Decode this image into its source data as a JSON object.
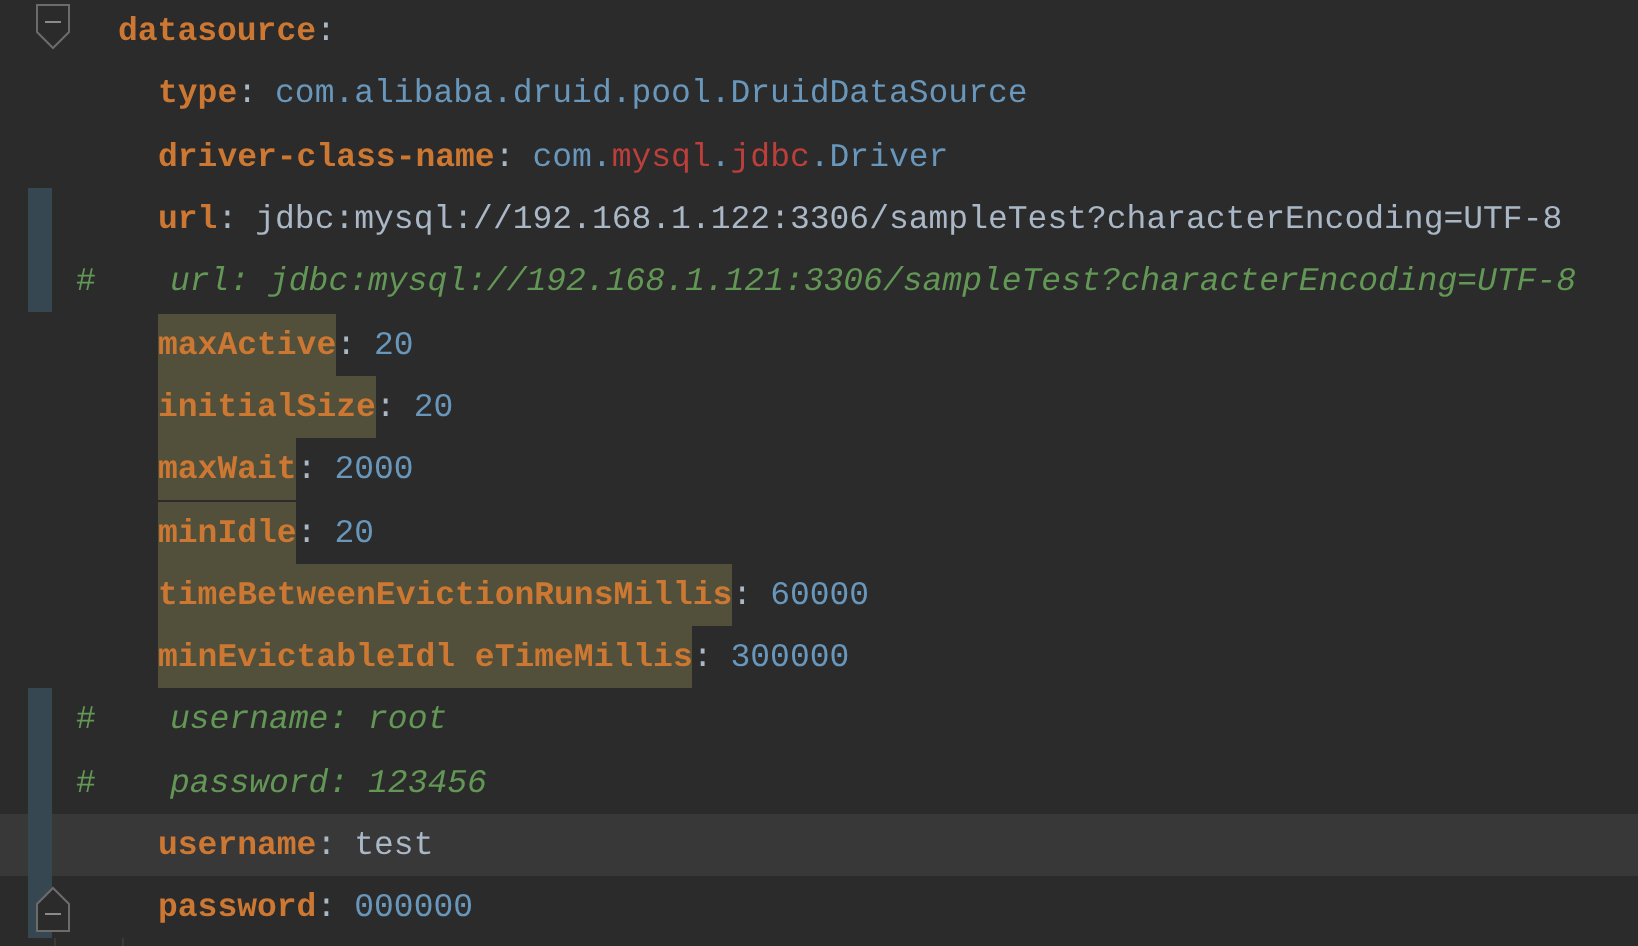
{
  "editor": {
    "lines": [
      {
        "kind": "key",
        "highlighted": false,
        "current": false,
        "changed": false,
        "tokens": [
          {
            "kind": "key",
            "text": "datasource"
          },
          {
            "kind": "punct",
            "text": ":"
          }
        ],
        "children": [
          {
            "kind": "key",
            "highlighted": false,
            "current": false,
            "changed": false,
            "tokens": [
              {
                "kind": "key",
                "text": "type"
              },
              {
                "kind": "punct",
                "text": ":"
              },
              {
                "kind": "value",
                "text": "com.alibaba.druid.pool.DruidDataSource"
              }
            ]
          },
          {
            "kind": "key",
            "highlighted": false,
            "current": false,
            "changed": false,
            "tokens": [
              {
                "kind": "key",
                "text": "driver-class-name"
              },
              {
                "kind": "punct",
                "text": ":"
              },
              {
                "kind": "value",
                "text": "com."
              },
              {
                "kind": "error",
                "text": "mysql"
              },
              {
                "kind": "value",
                "text": "."
              },
              {
                "kind": "error",
                "text": "jdbc"
              },
              {
                "kind": "value",
                "text": ".Driver"
              }
            ]
          },
          {
            "kind": "key",
            "highlighted": false,
            "current": false,
            "changed": true,
            "tokens": [
              {
                "kind": "key",
                "text": "url"
              },
              {
                "kind": "punct",
                "text": ":"
              },
              {
                "kind": "string",
                "text": "jdbc:mysql://192.168.1.122:3306/sampleTest?characterEncoding=UTF-8"
              }
            ]
          },
          {
            "kind": "comment",
            "highlighted": false,
            "current": false,
            "changed": true,
            "mark": "#",
            "text": "url: jdbc:mysql://192.168.1.121:3306/sampleTest?characterEncoding=UTF-8"
          },
          {
            "kind": "key",
            "highlighted": true,
            "current": false,
            "changed": false,
            "tokens": [
              {
                "kind": "key",
                "text": "maxActive"
              },
              {
                "kind": "punct",
                "text": ":"
              },
              {
                "kind": "number",
                "text": "20"
              }
            ]
          },
          {
            "kind": "key",
            "highlighted": true,
            "current": false,
            "changed": false,
            "tokens": [
              {
                "kind": "key",
                "text": "initialSize"
              },
              {
                "kind": "punct",
                "text": ":"
              },
              {
                "kind": "number",
                "text": "20"
              }
            ]
          },
          {
            "kind": "key",
            "highlighted": true,
            "current": false,
            "changed": false,
            "tokens": [
              {
                "kind": "key",
                "text": "maxWait"
              },
              {
                "kind": "punct",
                "text": ":"
              },
              {
                "kind": "number",
                "text": "2000"
              }
            ]
          },
          {
            "kind": "key",
            "highlighted": true,
            "current": false,
            "changed": false,
            "tokens": [
              {
                "kind": "key",
                "text": "minIdle"
              },
              {
                "kind": "punct",
                "text": ":"
              },
              {
                "kind": "number",
                "text": "20"
              }
            ]
          },
          {
            "kind": "key",
            "highlighted": true,
            "current": false,
            "changed": false,
            "tokens": [
              {
                "kind": "key",
                "text": "timeBetweenEvictionRunsMillis"
              },
              {
                "kind": "punct",
                "text": ":"
              },
              {
                "kind": "number",
                "text": "60000"
              }
            ]
          },
          {
            "kind": "key",
            "highlighted": true,
            "current": false,
            "changed": false,
            "tokens": [
              {
                "kind": "key",
                "text": "minEvictableIdl eTimeMillis"
              },
              {
                "kind": "punct",
                "text": ":"
              },
              {
                "kind": "number",
                "text": "300000"
              }
            ]
          },
          {
            "kind": "comment",
            "highlighted": false,
            "current": false,
            "changed": true,
            "mark": "#",
            "text": "username: root"
          },
          {
            "kind": "comment",
            "highlighted": false,
            "current": false,
            "changed": true,
            "mark": "#",
            "text": "password: 123456"
          },
          {
            "kind": "key",
            "highlighted": false,
            "current": true,
            "changed": true,
            "tokens": [
              {
                "kind": "key",
                "text": "username"
              },
              {
                "kind": "punct",
                "text": ":"
              },
              {
                "kind": "string",
                "text": "test"
              }
            ]
          },
          {
            "kind": "key",
            "highlighted": false,
            "current": false,
            "changed": true,
            "tokens": [
              {
                "kind": "key",
                "text": "password"
              },
              {
                "kind": "punct",
                "text": ":"
              },
              {
                "kind": "number",
                "text": "000000"
              }
            ]
          }
        ]
      }
    ]
  }
}
